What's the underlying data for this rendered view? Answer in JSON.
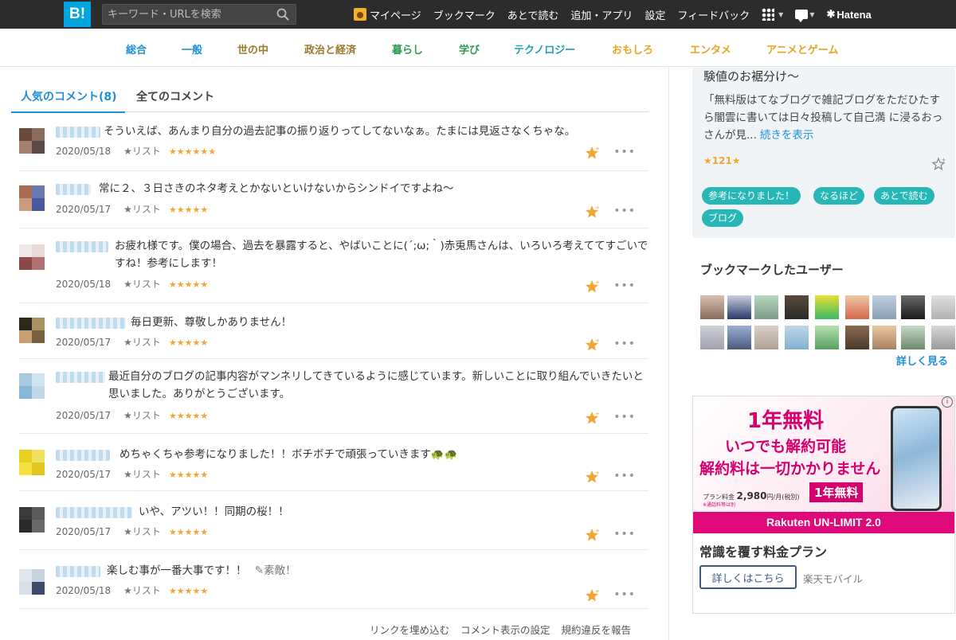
{
  "header": {
    "logo_text": "B!",
    "search_placeholder": "キーワード・URLを検索",
    "nav": {
      "mypage": "マイページ",
      "bookmark": "ブックマーク",
      "later": "あとで読む",
      "add_app": "追加・アプリ",
      "settings": "設定",
      "feedback": "フィードバック",
      "brand": "Hatena"
    }
  },
  "categories": [
    {
      "label": "総合",
      "color": "#1f8fd6"
    },
    {
      "label": "一般",
      "color": "#1f8fd6"
    },
    {
      "label": "世の中",
      "color": "#9a7a2e"
    },
    {
      "label": "政治と経済",
      "color": "#9a7a2e"
    },
    {
      "label": "暮らし",
      "color": "#2e9a52"
    },
    {
      "label": "学び",
      "color": "#2e9a52"
    },
    {
      "label": "テクノロジー",
      "color": "#1fa0b8"
    },
    {
      "label": "おもしろ",
      "color": "#e8a321"
    },
    {
      "label": "エンタメ",
      "color": "#e8a321"
    },
    {
      "label": "アニメとゲーム",
      "color": "#e8a321"
    }
  ],
  "tabs": {
    "popular": "人気のコメント(8)",
    "all": "全てのコメント"
  },
  "comments": [
    {
      "text": "そういえば、あんまり自分の過去記事の振り返りってしてないなぁ。たまには見返さなくちゃな。",
      "date": "2020/05/18",
      "list": "★リスト",
      "stars": "★★★★★★"
    },
    {
      "text": "常に２、３日さきのネタ考えとかないといけないからシンドイですよね〜",
      "date": "2020/05/17",
      "list": "★リスト",
      "stars": "★★★★★"
    },
    {
      "text": "お疲れ様です。僕の場合、過去を暴露すると、やばいことに(´;ω;｀)赤兎馬さんは、いろいろ考えててすごいですね！参考にします！",
      "date": "2020/05/18",
      "list": "★リスト",
      "stars": "★★★★★"
    },
    {
      "text": "毎日更新、尊敬しかありません！",
      "date": "2020/05/17",
      "list": "★リスト",
      "stars": "★★★★★"
    },
    {
      "text": "最近自分のブログの記事内容がマンネリしてきているように感じています。新しいことに取り組んでいきたいと思いました。ありがとうございます。",
      "date": "2020/05/17",
      "list": "★リスト",
      "stars": "★★★★★"
    },
    {
      "text": "めちゃくちゃ参考になりました！！ボチボチで頑張っていきます🐢🐢",
      "date": "2020/05/17",
      "list": "★リスト",
      "stars": "★★★★★"
    },
    {
      "text": "いや、アツい！！同期の桜！！",
      "date": "2020/05/17",
      "list": "★リスト",
      "stars": "★★★★★"
    },
    {
      "text": "楽しむ事が一番大事です！！",
      "tag": "素敵！",
      "date": "2020/05/18",
      "list": "★リスト",
      "stars": "★★★★★"
    }
  ],
  "footer_links": {
    "embed": "リンクを埋め込む",
    "display_settings": "コメント表示の設定",
    "report": "規約違反を報告"
  },
  "entry": {
    "title": "験値のお裾分け〜",
    "description": "「無料版はてなブログで雑記ブログをただひたすら闇雲に書いては日々投稿して自己満 に浸るおっさんが見...",
    "more_label": "続きを表示",
    "star_count": "★121★",
    "tags": [
      "参考になりました！",
      "なるほど",
      "あとで読む",
      "ブログ"
    ]
  },
  "bookmark_users": {
    "title": "ブックマークしたユーザー",
    "more": "詳しく見る"
  },
  "ad": {
    "headline1": "1年無料",
    "headline2": "いつでも解約可能",
    "headline3": "解約料は一切かかりません",
    "plan_price_prefix": "プラン料金",
    "plan_price": "2,980",
    "plan_price_suffix": "円/月(税別)",
    "note": "※通話料等は別",
    "badge": "1年無料",
    "strip": "Rakuten UN-LIMIT 2.0",
    "title": "常識を覆す料金プラン",
    "button": "詳しくはこちら",
    "sponsor": "楽天モバイル",
    "info_icon": "i"
  }
}
